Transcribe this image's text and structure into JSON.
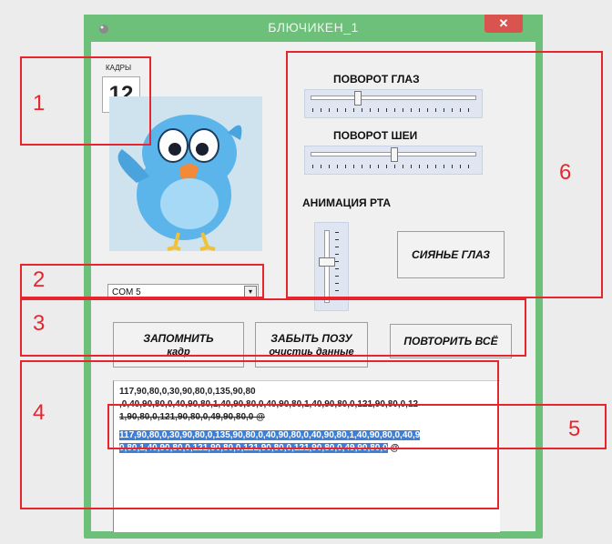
{
  "window": {
    "title": "БЛЮЧИКЕН_1",
    "close_glyph": "✕"
  },
  "frames": {
    "label": "КАДРЫ",
    "value": "12"
  },
  "port": {
    "selected": "COM 5",
    "arrow": "▾"
  },
  "controls": {
    "eye_label": "ПОВОРОТ ГЛАЗ",
    "neck_label": "ПОВОРОТ ШЕИ",
    "mouth_label": "АНИМАЦИЯ РТА",
    "glow_button": "СИЯНЬЕ ГЛАЗ",
    "eye_slider_value": 0.3,
    "neck_slider_value": 0.5,
    "mouth_slider_value": 0.6
  },
  "buttons": {
    "save_line1": "ЗАПОМНИТЬ",
    "save_line2": "кадр",
    "forget_line1": "ЗАБЫТЬ ПОЗУ",
    "forget_line2": "очистиь данные",
    "repeat": "ПОВТОРИТЬ ВСЁ"
  },
  "memo": {
    "line1": "117,90,80,0,30,90,80,0,135,90,80",
    "line2": ",0,40,90,80,0,40,90,80,1,40,90,80,0,40,90,80,1,40,90,80,0,121,90,80,0,12",
    "line3": "1,90,80,0,121,90,80,0,49,90,80,0 @",
    "line4": "117,90,80,0,30,90,80,0,135,90,80,0,40,90,80,0,40,90,80,1,40,90,80,0,40,9",
    "line5": "0,80,1,40,90,80,0,121,90,80,0,121,90,80,0,121,90,80,0,49,90,80,0",
    "line5_tail": " @"
  },
  "annotations": {
    "n1": "1",
    "n2": "2",
    "n3": "3",
    "n4": "4",
    "n5": "5",
    "n6": "6"
  },
  "colors": {
    "window_frame": "#6cc07a",
    "annotation": "#e8252f",
    "selection": "#3d7fd6"
  }
}
